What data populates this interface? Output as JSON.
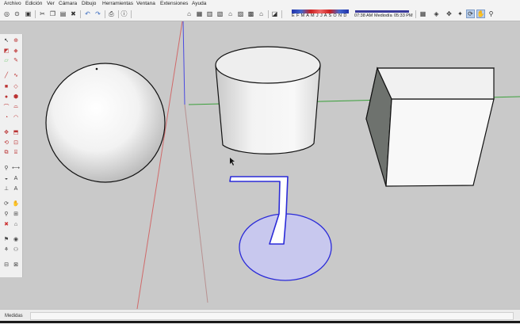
{
  "menu": {
    "items": [
      "Archivo",
      "Edición",
      "Ver",
      "Cámara",
      "Dibujo",
      "Herramientas",
      "Ventana",
      "Extensiones",
      "Ayuda"
    ]
  },
  "toolbar": {
    "months": "E F M A M J J A S O N D",
    "sunrise": "07:38 AM",
    "midday": "Mediodía",
    "sunset": "05:33 PM"
  },
  "statusbar": {
    "measurements_label": "Medidas"
  },
  "colors": {
    "accent": "#3355cc",
    "selection_fill": "#c8c8ee",
    "axis_red": "#d04040",
    "axis_green": "#3aa03a",
    "axis_blue": "#4a4ae0"
  },
  "icons": {
    "toolbar": [
      "select-icon",
      "save-icon",
      "cut-icon",
      "copy-icon",
      "paste-icon",
      "erase-icon",
      "undo-icon",
      "redo-icon",
      "print-icon",
      "model-info-icon",
      "iso-view-icon",
      "top-view-icon",
      "front-view-icon",
      "right-view-icon",
      "back-view-icon",
      "left-view-icon",
      "bottom-view-icon",
      "shadows-icon",
      "fog-icon",
      "perspective-icon",
      "orbit-icon",
      "pan-icon",
      "zoom-icon"
    ],
    "sidebar": [
      "select-icon",
      "component-icon",
      "paint-icon",
      "eraser-icon",
      "line-icon",
      "freehand-icon",
      "rectangle-icon",
      "rotated-rectangle-icon",
      "circle-icon",
      "polygon-icon",
      "arc-icon",
      "pie-icon",
      "move-icon",
      "push-pull-icon",
      "rotate-icon",
      "follow-me-icon",
      "scale-icon",
      "offset-icon",
      "tape-icon",
      "dimension-icon",
      "protractor-icon",
      "text-icon",
      "axes-icon",
      "3d-text-icon",
      "orbit-icon",
      "pan-icon",
      "zoom-icon",
      "zoom-window-icon",
      "zoom-extents-icon",
      "previous-icon",
      "position-camera-icon",
      "walk-icon",
      "look-around-icon",
      "section-icon"
    ]
  }
}
